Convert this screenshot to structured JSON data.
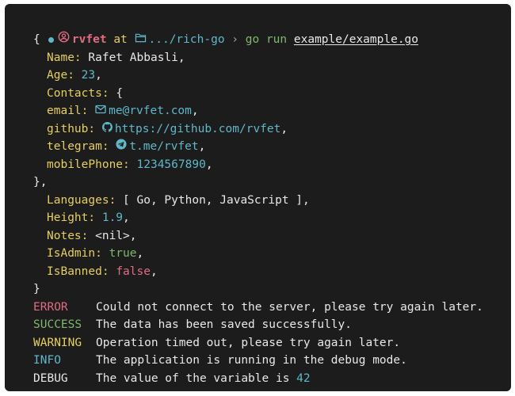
{
  "prompt": {
    "user": "rvfet",
    "at": "at",
    "path": ".../rich-go",
    "separator": "›",
    "command": "go run",
    "file": "example/example.go"
  },
  "output": {
    "open_brace": "{",
    "name_key": "Name:",
    "name_val": "Rafet Abbasli,",
    "age_key": "Age:",
    "age_val": "23",
    "contacts_key": "Contacts:",
    "contacts_open": "{",
    "email_key": "email:",
    "email_val": "me@rvfet.com",
    "github_key": "github:",
    "github_val": "https://github.com/rvfet",
    "telegram_key": "telegram:",
    "telegram_val": "t.me/rvfet",
    "mobile_key": "mobilePhone:",
    "mobile_val": "1234567890",
    "contacts_close": "},",
    "languages_key": "Languages:",
    "languages_val": "[ Go, Python, JavaScript ],",
    "height_key": "Height:",
    "height_val": "1.9",
    "notes_key": "Notes:",
    "notes_val": "<nil>,",
    "isadmin_key": "IsAdmin:",
    "isadmin_val": "true",
    "isbanned_key": "IsBanned:",
    "isbanned_val": "false",
    "close_brace": "}",
    "comma": ","
  },
  "logs": [
    {
      "level": "ERROR",
      "message": "Could not connect to the server, please try again later.",
      "color": "#e06c82"
    },
    {
      "level": "SUCCESS",
      "message": "The data has been saved successfully.",
      "color": "#7fb86a"
    },
    {
      "level": "WARNING",
      "message": "Operation timed out, please try again later.",
      "color": "#e6cf61"
    },
    {
      "level": "INFO",
      "message": "The application is running in the debug mode.",
      "color": "#5fb8c9"
    },
    {
      "level": "DEBUG",
      "message": "The value of the variable is",
      "value": "42",
      "color": "#e8e8e8"
    }
  ],
  "icons": {
    "prompt_dot": "status-dot-icon",
    "user": "user-circle-icon",
    "folder": "folder-icon",
    "email": "envelope-icon",
    "github": "github-icon",
    "telegram": "telegram-icon"
  },
  "colors": {
    "background": "#1c1c1c",
    "key": "#e6cf61",
    "number": "#5fb8c9",
    "true": "#7fb86a",
    "false": "#e06c82",
    "prompt_user": "#e06c82",
    "prompt_path": "#5fb8c9",
    "prompt_command": "#7fb86a"
  }
}
